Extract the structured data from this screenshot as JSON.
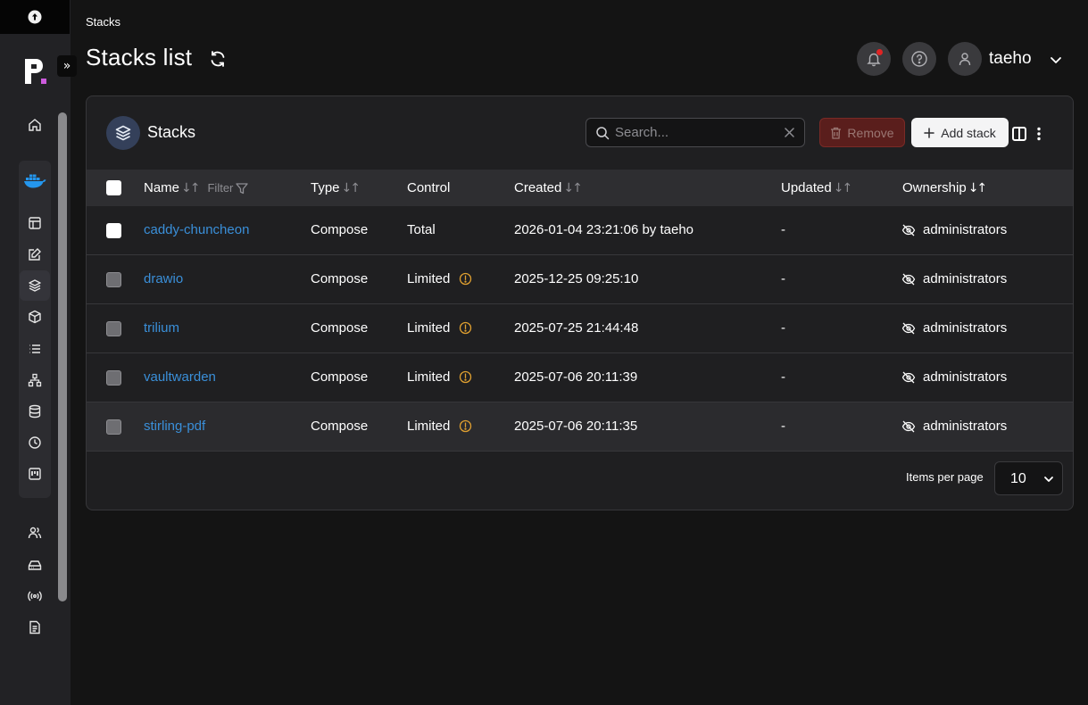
{
  "breadcrumb": "Stacks",
  "page_title": "Stacks list",
  "user": {
    "name": "taeho"
  },
  "panel": {
    "title": "Stacks",
    "search_placeholder": "Search...",
    "remove_label": "Remove",
    "add_label": "Add stack"
  },
  "table": {
    "headers": {
      "name": "Name",
      "filter": "Filter",
      "type": "Type",
      "control": "Control",
      "created": "Created",
      "updated": "Updated",
      "ownership": "Ownership"
    },
    "rows": [
      {
        "name": "caddy-chuncheon",
        "type": "Compose",
        "control": "Total",
        "created": "2026-01-04 23:21:06 by taeho",
        "updated": "-",
        "ownership": "administrators"
      },
      {
        "name": "drawio",
        "type": "Compose",
        "control": "Limited",
        "created": "2025-12-25 09:25:10",
        "updated": "-",
        "ownership": "administrators"
      },
      {
        "name": "trilium",
        "type": "Compose",
        "control": "Limited",
        "created": "2025-07-25 21:44:48",
        "updated": "-",
        "ownership": "administrators"
      },
      {
        "name": "vaultwarden",
        "type": "Compose",
        "control": "Limited",
        "created": "2025-07-06 20:11:39",
        "updated": "-",
        "ownership": "administrators"
      },
      {
        "name": "stirling-pdf",
        "type": "Compose",
        "control": "Limited",
        "created": "2025-07-06 20:11:35",
        "updated": "-",
        "ownership": "administrators"
      }
    ]
  },
  "pagination": {
    "items_per_page_label": "Items per page",
    "items_per_page": "10"
  },
  "colors": {
    "accent": "#3a8fd9",
    "warning": "#e0a030",
    "background": "#141414",
    "panel": "#1f1f21"
  },
  "icons": {
    "sidebar": [
      "home-icon",
      "docker-icon",
      "templates-icon",
      "edit-icon",
      "stacks-icon",
      "containers-icon",
      "list-icon",
      "network-icon",
      "database-icon",
      "clock-icon",
      "kanban-icon",
      "users-icon",
      "drive-icon",
      "broadcast-icon",
      "document-icon"
    ]
  }
}
